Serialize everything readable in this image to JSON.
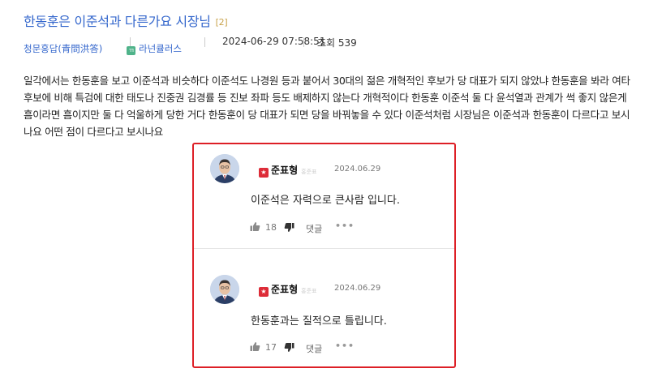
{
  "post": {
    "title": "한동훈은 이준석과 다른가요 시장님",
    "comment_count": "[2]",
    "author": "청문홍답(青問洪答)",
    "badge_label": "라넌큘러스",
    "badge_icon": "ㄲ",
    "date": "2024-06-29 07:58:51",
    "views": "조회 539",
    "body_lines": [
      "일각에서는 한동훈을 보고 이준석과 비슷하다 이준석도 나경원 등과 붙어서 30대의 젊은 개혁적인 후보가 당 대표가 되지 않았냐 한동훈을 봐라 여타",
      "후보에 비해 특검에 대한 태도나 진중권 김경률 등 진보 좌파 등도 배제하지 않는다 개혁적이다 한동훈 이준석 둘 다 윤석열과 관계가 썩 좋지 않은게",
      "흠이라면 흠이지만 둘 다 억울하게 당한 거다 한동훈이 당 대표가 되면 당을 바꿔놓을 수 있다 이준석처럼 시장님은 이준석과 한동훈이 다르다고 보시",
      "나요 어떤 점이 다르다고 보시나요"
    ]
  },
  "comments": [
    {
      "author": "준표형",
      "author_tag": "홍준표",
      "date": "2024.06.29",
      "text": "이준석은 자력으로 큰사람 입니다.",
      "likes": "18",
      "reply_label": "댓글",
      "more_label": "•••"
    },
    {
      "author": "준표형",
      "author_tag": "홍준표",
      "date": "2024.06.29",
      "text": "한동훈과는 질적으로 틀립니다.",
      "likes": "17",
      "reply_label": "댓글",
      "more_label": "•••"
    }
  ],
  "colors": {
    "title": "#3366cc",
    "highlight_border": "#dd1f26",
    "star_badge": "#dd2c38",
    "level_badge": "#4fb38a"
  }
}
